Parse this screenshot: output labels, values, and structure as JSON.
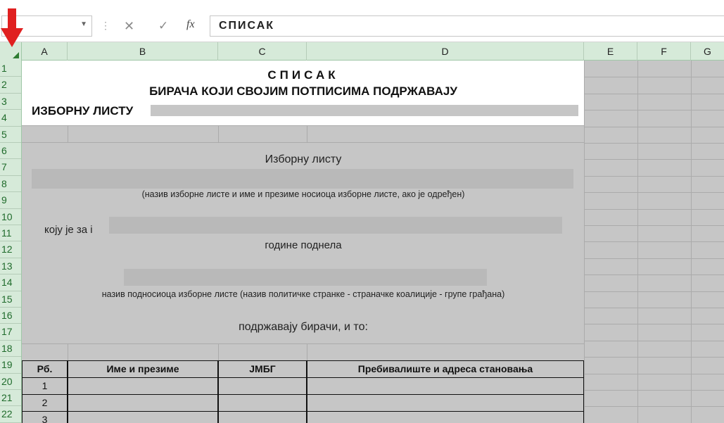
{
  "formula_bar": {
    "name_box": "",
    "cancel_icon": "close-icon",
    "enter_icon": "check-icon",
    "function_label": "fx",
    "content": "СПИСАК"
  },
  "columns": [
    "A",
    "B",
    "C",
    "D",
    "E",
    "F",
    "G"
  ],
  "rows": [
    "1",
    "2",
    "3",
    "4",
    "5",
    "6",
    "7",
    "8",
    "9",
    "10",
    "11",
    "12",
    "13",
    "14",
    "15",
    "16",
    "17",
    "18",
    "19",
    "20",
    "21",
    "22"
  ],
  "sheet": {
    "title_line1": "СПИСАК",
    "title_line2": "БИРАЧА КОЈИ СВОЈИМ ПОТПИСИМА ПОДРЖАВАЈУ",
    "title_line3": "ИЗБОРНУ ЛИСТУ",
    "izbornu_listu": "Изборну листу",
    "naziv_note": "(назив изборне листе и име и презиме носиоца изборне листе, ако је одређен)",
    "koja_je": "коју је за і",
    "godine": "године поднела",
    "podnosioc_note": "назив подносиоца изборне листе (назив политичке странке - страначке коалиције - групе грађана)",
    "podrzavaju": "подржавају бирачи, и то:"
  },
  "table": {
    "headers": [
      "Рб.",
      "Име и презиме",
      "ЈМБГ",
      "Пребивалиште и адреса становања"
    ],
    "rows": [
      "1",
      "2",
      "3"
    ]
  },
  "colors": {
    "header_green": "#d6ead9",
    "grid_gray": "#c6c6c6",
    "arrow_red": "#e02020"
  }
}
